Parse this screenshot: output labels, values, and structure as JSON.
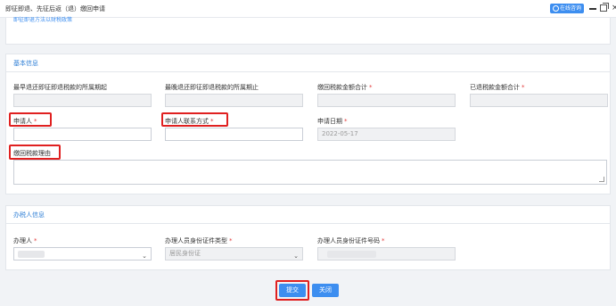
{
  "window": {
    "title": "即征即退、先征后返（退）缴回申请",
    "online_label": "在线咨询",
    "minimize_icon": "minimize-icon",
    "maximize_icon": "maximize-icon",
    "close_icon": "close-icon"
  },
  "top_panel": {
    "cut_text": "即征即退方法以财税政策"
  },
  "basic_info": {
    "section_title": "基本信息",
    "fields": {
      "earliest_period_label": "最早退还即征即退税款的所属期起",
      "latest_period_label": "最晚退还即征即退税款的所属期止",
      "returned_total_label": "缴回税款金额合计",
      "refunded_total_label": "已退税款金额合计",
      "applicant_label": "申请人",
      "applicant_contact_label": "申请人联系方式",
      "apply_date_label": "申请日期",
      "apply_date_value": "2022-05-17",
      "reason_label": "缴回税款理由"
    },
    "required_mark": "*"
  },
  "handler_info": {
    "section_title": "办税人信息",
    "handler_label": "办理人",
    "id_type_label": "办理人员身份证件类型",
    "id_type_value": "居民身份证",
    "id_number_label": "办理人员身份证件号码",
    "required_mark": "*"
  },
  "actions": {
    "submit_label": "提交",
    "close_label": "关闭"
  },
  "colors": {
    "accent": "#3d8ef0",
    "section_title": "#2f7fd6",
    "required": "#e23b3b",
    "highlight": "#e02020"
  }
}
